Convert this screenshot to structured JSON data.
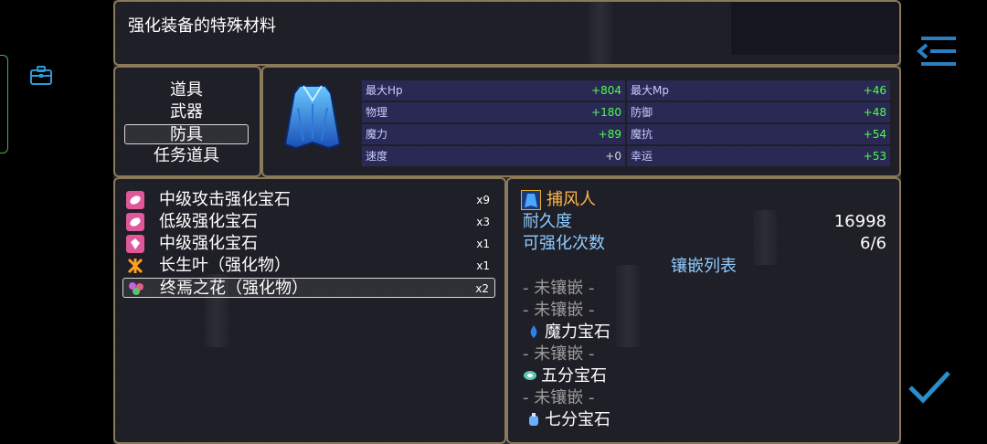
{
  "help_window": {
    "text": "强化装备的特殊材料"
  },
  "categories": [
    {
      "label": "道具",
      "selected": false
    },
    {
      "label": "武器",
      "selected": false
    },
    {
      "label": "防具",
      "selected": true
    },
    {
      "label": "任务道具",
      "selected": false
    }
  ],
  "equip_preview": {
    "icon": "blue-cloak-icon",
    "stats": [
      {
        "label": "最大Hp",
        "value": "+804"
      },
      {
        "label": "最大Mp",
        "value": "+46"
      },
      {
        "label": "物理",
        "value": "+180"
      },
      {
        "label": "防御",
        "value": "+48"
      },
      {
        "label": "魔力",
        "value": "+89"
      },
      {
        "label": "魔抗",
        "value": "+54"
      },
      {
        "label": "速度",
        "value": "+0"
      },
      {
        "label": "幸运",
        "value": "+53"
      }
    ]
  },
  "items": [
    {
      "name": "中级攻击强化宝石",
      "count": "x9",
      "icon": "pink-gem-icon",
      "selected": false
    },
    {
      "name": "低级强化宝石",
      "count": "x3",
      "icon": "pink-gem-icon",
      "selected": false
    },
    {
      "name": "中级强化宝石",
      "count": "x1",
      "icon": "pink-crystal-icon",
      "selected": false
    },
    {
      "name": "长生叶（强化物）",
      "count": "x1",
      "icon": "orange-leaf-icon",
      "selected": false
    },
    {
      "name": "终焉之花（强化物）",
      "count": "x2",
      "icon": "flower-icon",
      "selected": true
    }
  ],
  "detail": {
    "equip_name": "捕风人",
    "durability_label": "耐久度",
    "durability_value": "16998",
    "enhance_label": "可强化次数",
    "enhance_value": "6/6",
    "socket_header": "镶嵌列表",
    "sockets": [
      {
        "text": "- 未镶嵌 -",
        "filled": false,
        "icon": ""
      },
      {
        "text": "- 未镶嵌 -",
        "filled": false,
        "icon": ""
      },
      {
        "text": "魔力宝石",
        "filled": true,
        "icon": "blue-drop-gem-icon"
      },
      {
        "text": "- 未镶嵌 -",
        "filled": false,
        "icon": ""
      },
      {
        "text": "五分宝石",
        "filled": true,
        "icon": "swirl-gem-icon"
      },
      {
        "text": "- 未镶嵌 -",
        "filled": false,
        "icon": ""
      },
      {
        "text": "七分宝石",
        "filled": true,
        "icon": "blue-bottle-gem-icon"
      }
    ]
  },
  "colors": {
    "stat_positive": "#4cff4c",
    "highlight_label": "#8ecbff",
    "equip_name": "#ffb84a",
    "confirm": "#2a8ec8",
    "frame": "#8a7a5a"
  }
}
